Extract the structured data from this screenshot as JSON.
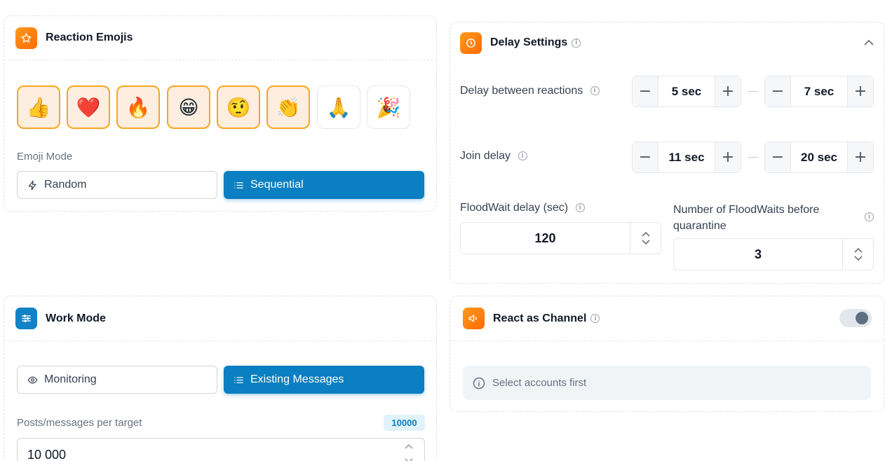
{
  "reaction_emojis": {
    "title": "Reaction Emojis",
    "emojis": [
      {
        "char": "👍",
        "selected": true,
        "name": "thumbs-up"
      },
      {
        "char": "❤️",
        "selected": true,
        "name": "heart"
      },
      {
        "char": "🔥",
        "selected": true,
        "name": "fire"
      },
      {
        "char": "😁",
        "selected": true,
        "name": "grin"
      },
      {
        "char": "🤨",
        "selected": true,
        "name": "skeptical"
      },
      {
        "char": "👏",
        "selected": true,
        "name": "clap"
      },
      {
        "char": "🙏",
        "selected": false,
        "name": "pray"
      },
      {
        "char": "🎉",
        "selected": false,
        "name": "party"
      }
    ],
    "mode_label": "Emoji Mode",
    "mode_random": "Random",
    "mode_sequential": "Sequential",
    "mode_selected": "Sequential"
  },
  "delay_settings": {
    "title": "Delay Settings",
    "delay_between_label": "Delay between reactions",
    "delay_min": "5 sec",
    "delay_max": "7 sec",
    "join_delay_label": "Join delay",
    "join_min": "11 sec",
    "join_max": "20 sec",
    "floodwait_label": "FloodWait delay (sec)",
    "floodwait_value": "120",
    "floodwait_count_label": "Number of FloodWaits before quarantine",
    "floodwait_count_value": "3"
  },
  "work_mode": {
    "title": "Work Mode",
    "monitoring": "Monitoring",
    "existing": "Existing Messages",
    "selected": "Existing Messages",
    "posts_label": "Posts/messages per target",
    "posts_badge": "10000",
    "posts_value": "10 000"
  },
  "react_as_channel": {
    "title": "React as Channel",
    "toggle_on": false,
    "notice": "Select accounts first"
  },
  "colors": {
    "accent_blue": "#0a7fc1",
    "accent_orange": "#ff7a00",
    "selected_emoji_bg": "#fdeedf",
    "selected_emoji_border": "#f5a623"
  }
}
